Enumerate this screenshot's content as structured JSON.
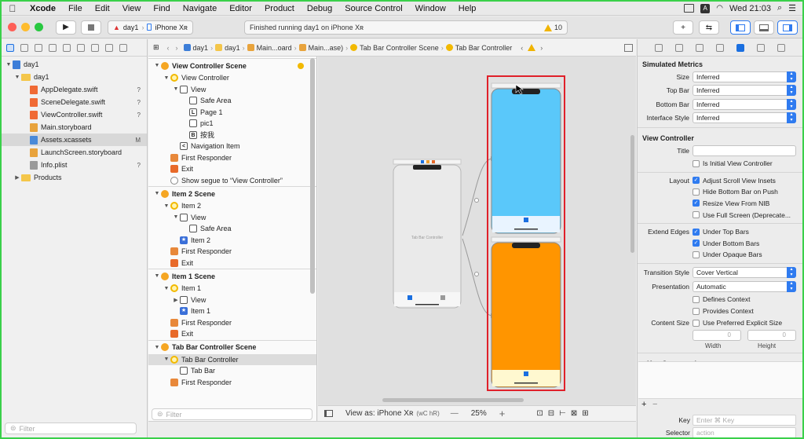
{
  "menubar": {
    "items": [
      "Xcode",
      "File",
      "Edit",
      "View",
      "Find",
      "Navigate",
      "Editor",
      "Product",
      "Debug",
      "Source Control",
      "Window",
      "Help"
    ],
    "a_icon": "A",
    "clock": "Wed 21:03"
  },
  "toolbar": {
    "scheme": "day1",
    "device": "iPhone Xʀ",
    "status": "Finished running day1 on iPhone Xʀ",
    "warning_count": "10",
    "colors": {
      "close": "#fe5f57",
      "minimize": "#febc2e",
      "zoom": "#28c840",
      "accent": "#2f7bf0"
    }
  },
  "navigator": {
    "items": [
      {
        "label": "day1",
        "indent": 0,
        "disc": "▼",
        "kind": "project"
      },
      {
        "label": "day1",
        "indent": 1,
        "disc": "▼",
        "kind": "folder"
      },
      {
        "label": "AppDelegate.swift",
        "indent": 2,
        "badge": "?",
        "kind": "swift"
      },
      {
        "label": "SceneDelegate.swift",
        "indent": 2,
        "badge": "?",
        "kind": "swift"
      },
      {
        "label": "ViewController.swift",
        "indent": 2,
        "badge": "?",
        "kind": "swift"
      },
      {
        "label": "Main.storyboard",
        "indent": 2,
        "kind": "storyboard"
      },
      {
        "label": "Assets.xcassets",
        "indent": 2,
        "badge": "M",
        "kind": "assets",
        "selected": true
      },
      {
        "label": "LaunchScreen.storyboard",
        "indent": 2,
        "kind": "storyboard"
      },
      {
        "label": "Info.plist",
        "indent": 2,
        "badge": "?",
        "kind": "plist"
      },
      {
        "label": "Products",
        "indent": 1,
        "disc": "▶",
        "kind": "folder"
      }
    ],
    "filter_placeholder": "Filter"
  },
  "jumpbar": {
    "crumbs": [
      "day1",
      "day1",
      "Main...oard",
      "Main...ase)",
      "Tab Bar Controller Scene",
      "Tab Bar Controller"
    ]
  },
  "outline": {
    "rows": [
      {
        "label": "View Controller Scene",
        "indent": 0,
        "disc": "▼",
        "type": "scene",
        "dot": true
      },
      {
        "label": "View Controller",
        "indent": 1,
        "disc": "▼",
        "type": "vc"
      },
      {
        "label": "View",
        "indent": 2,
        "disc": "▼",
        "type": "view"
      },
      {
        "label": "Safe Area",
        "indent": 3,
        "type": "safe"
      },
      {
        "label": "Page 1",
        "indent": 3,
        "type": "label",
        "glyph": "L"
      },
      {
        "label": "pic1",
        "indent": 3,
        "type": "image"
      },
      {
        "label": "按我",
        "indent": 3,
        "type": "button",
        "glyph": "B"
      },
      {
        "label": "Navigation Item",
        "indent": 2,
        "type": "navitem",
        "glyph": "<"
      },
      {
        "label": "First Responder",
        "indent": 1,
        "type": "cube"
      },
      {
        "label": "Exit",
        "indent": 1,
        "type": "exit"
      },
      {
        "label": "Show segue to “View Controller”",
        "indent": 1,
        "type": "segue"
      },
      {
        "label": "Item 2 Scene",
        "indent": 0,
        "disc": "▼",
        "type": "scene"
      },
      {
        "label": "Item 2",
        "indent": 1,
        "disc": "▼",
        "type": "vc"
      },
      {
        "label": "View",
        "indent": 2,
        "disc": "▼",
        "type": "view"
      },
      {
        "label": "Safe Area",
        "indent": 3,
        "type": "safe"
      },
      {
        "label": "Item 2",
        "indent": 2,
        "type": "star"
      },
      {
        "label": "First Responder",
        "indent": 1,
        "type": "cube"
      },
      {
        "label": "Exit",
        "indent": 1,
        "type": "exit"
      },
      {
        "label": "Item 1 Scene",
        "indent": 0,
        "disc": "▼",
        "type": "scene"
      },
      {
        "label": "Item 1",
        "indent": 1,
        "disc": "▼",
        "type": "vc"
      },
      {
        "label": "View",
        "indent": 2,
        "disc": "▶",
        "type": "view"
      },
      {
        "label": "Item 1",
        "indent": 2,
        "type": "star"
      },
      {
        "label": "First Responder",
        "indent": 1,
        "type": "cube"
      },
      {
        "label": "Exit",
        "indent": 1,
        "type": "exit"
      },
      {
        "label": "Tab Bar Controller Scene",
        "indent": 0,
        "disc": "▼",
        "type": "scene"
      },
      {
        "label": "Tab Bar Controller",
        "indent": 1,
        "disc": "▼",
        "type": "tbc",
        "selected": true
      },
      {
        "label": "Tab Bar",
        "indent": 2,
        "type": "tabbar"
      },
      {
        "label": "First Responder",
        "indent": 1,
        "type": "cube"
      }
    ],
    "filter_placeholder": "Filter"
  },
  "canvas": {
    "tab_bar_controller_label": "Tab Bar Controller",
    "view_as": "View as: iPhone Xʀ",
    "size_class": "(wC hR)",
    "zoom": "25%",
    "colors": {
      "item1": "#5ac8fa",
      "item2": "#ff9500",
      "selection": "#e0202a",
      "tab_blue": "#1a6fe0",
      "tabbar_bg": "#fff8d0"
    }
  },
  "inspector": {
    "simulated_metrics": {
      "title": "Simulated Metrics",
      "rows": [
        {
          "label": "Size",
          "value": "Inferred"
        },
        {
          "label": "Top Bar",
          "value": "Inferred"
        },
        {
          "label": "Bottom Bar",
          "value": "Inferred"
        },
        {
          "label": "Interface Style",
          "value": "Inferred"
        }
      ]
    },
    "view_controller": {
      "title": "View Controller",
      "title_label": "Title",
      "title_value": "",
      "initial": "Is Initial View Controller",
      "layout_label": "Layout",
      "layout_opts": [
        {
          "label": "Adjust Scroll View Insets",
          "on": true
        },
        {
          "label": "Hide Bottom Bar on Push",
          "on": false
        },
        {
          "label": "Resize View From NIB",
          "on": true
        },
        {
          "label": "Use Full Screen (Deprecate...",
          "on": false
        }
      ],
      "extend_label": "Extend Edges",
      "extend_opts": [
        {
          "label": "Under Top Bars",
          "on": true
        },
        {
          "label": "Under Bottom Bars",
          "on": true
        },
        {
          "label": "Under Opaque Bars",
          "on": false
        }
      ],
      "transition_label": "Transition Style",
      "transition_value": "Cover Vertical",
      "presentation_label": "Presentation",
      "presentation_value": "Automatic",
      "defines_context": "Defines Context",
      "provides_context": "Provides Context",
      "content_size_label": "Content Size",
      "preferred_size": "Use Preferred Explicit Size",
      "width_value": "0",
      "height_value": "0",
      "width_label": "Width",
      "height_label": "Height"
    },
    "key_commands": {
      "title": "Key Commands",
      "key_label": "Key",
      "key_placeholder": "Enter ⌘ Key",
      "selector_label": "Selector",
      "selector_placeholder": "action"
    }
  }
}
